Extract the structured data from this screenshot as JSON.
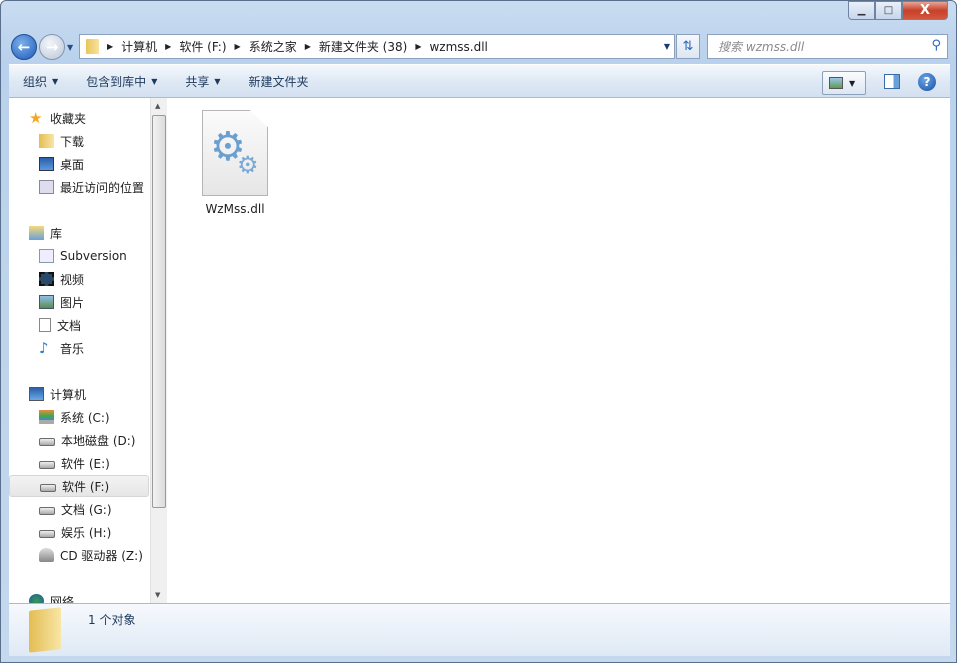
{
  "window": {
    "controls": {
      "minimize": "▁",
      "maximize": "□",
      "close": "X"
    }
  },
  "address": {
    "crumbs": [
      "计算机",
      "软件 (F:)",
      "系统之家",
      "新建文件夹 (38)",
      "wzmss.dll"
    ]
  },
  "search": {
    "placeholder": "搜索 wzmss.dll"
  },
  "toolbar": {
    "organize": "组织",
    "include": "包含到库中",
    "share": "共享",
    "new_folder": "新建文件夹"
  },
  "nav": {
    "favorites": {
      "label": "收藏夹",
      "items": [
        "下载",
        "桌面",
        "最近访问的位置"
      ]
    },
    "libraries": {
      "label": "库",
      "items": [
        "Subversion",
        "视频",
        "图片",
        "文档",
        "音乐"
      ]
    },
    "computer": {
      "label": "计算机",
      "items": [
        "系统 (C:)",
        "本地磁盘 (D:)",
        "软件 (E:)",
        "软件 (F:)",
        "文档 (G:)",
        "娱乐 (H:)",
        "CD 驱动器 (Z:)"
      ]
    },
    "network": {
      "label": "网络"
    }
  },
  "files": [
    {
      "name": "WzMss.dll",
      "icon": "dll-gear-icon"
    }
  ],
  "status": {
    "count": "1 个对象"
  }
}
